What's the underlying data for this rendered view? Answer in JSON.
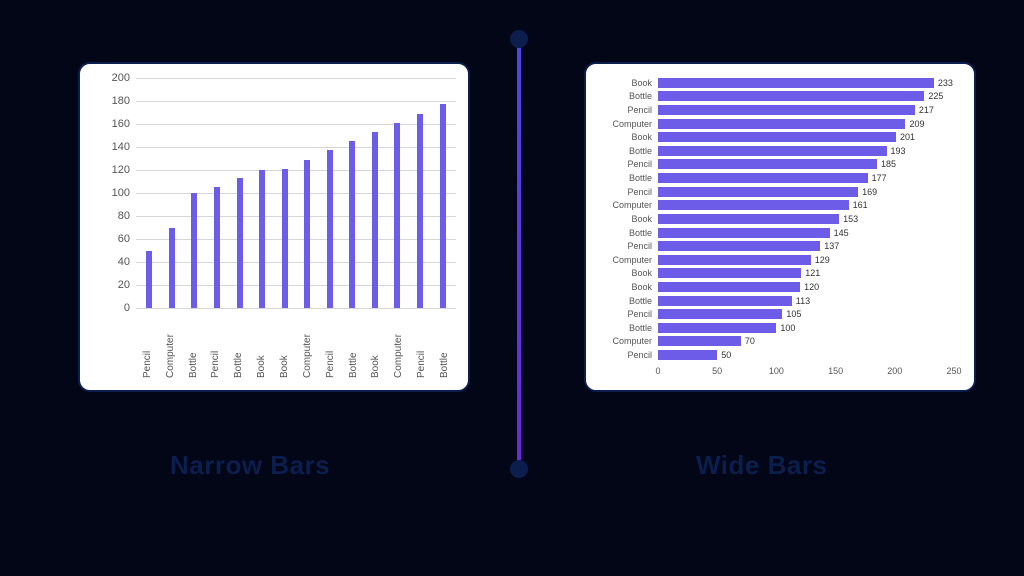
{
  "captions": {
    "left": "Narrow Bars",
    "right": "Wide Bars"
  },
  "chart_data": [
    {
      "type": "bar",
      "orientation": "vertical",
      "title": "",
      "xlabel": "",
      "ylabel": "",
      "ylim": [
        0,
        200
      ],
      "yticks": [
        0,
        20,
        40,
        60,
        80,
        100,
        120,
        140,
        160,
        180,
        200
      ],
      "categories": [
        "Pencil",
        "Computer",
        "Bottle",
        "Pencil",
        "Bottle",
        "Book",
        "Book",
        "Computer",
        "Pencil",
        "Bottle",
        "Book",
        "Computer",
        "Pencil",
        "Bottle"
      ],
      "values": [
        50,
        70,
        100,
        105,
        113,
        120,
        121,
        129,
        137,
        145,
        153,
        161,
        169,
        177
      ]
    },
    {
      "type": "bar",
      "orientation": "horizontal",
      "title": "",
      "xlabel": "",
      "ylabel": "",
      "xlim": [
        0,
        250
      ],
      "xticks": [
        0,
        50,
        100,
        150,
        200,
        250
      ],
      "categories": [
        "Book",
        "Bottle",
        "Pencil",
        "Computer",
        "Book",
        "Bottle",
        "Pencil",
        "Bottle",
        "Pencil",
        "Computer",
        "Book",
        "Bottle",
        "Pencil",
        "Computer",
        "Book",
        "Book",
        "Bottle",
        "Pencil",
        "Bottle",
        "Computer",
        "Pencil"
      ],
      "values": [
        233,
        225,
        217,
        209,
        201,
        193,
        185,
        177,
        169,
        161,
        153,
        145,
        137,
        129,
        121,
        120,
        113,
        105,
        100,
        70,
        50
      ]
    }
  ]
}
